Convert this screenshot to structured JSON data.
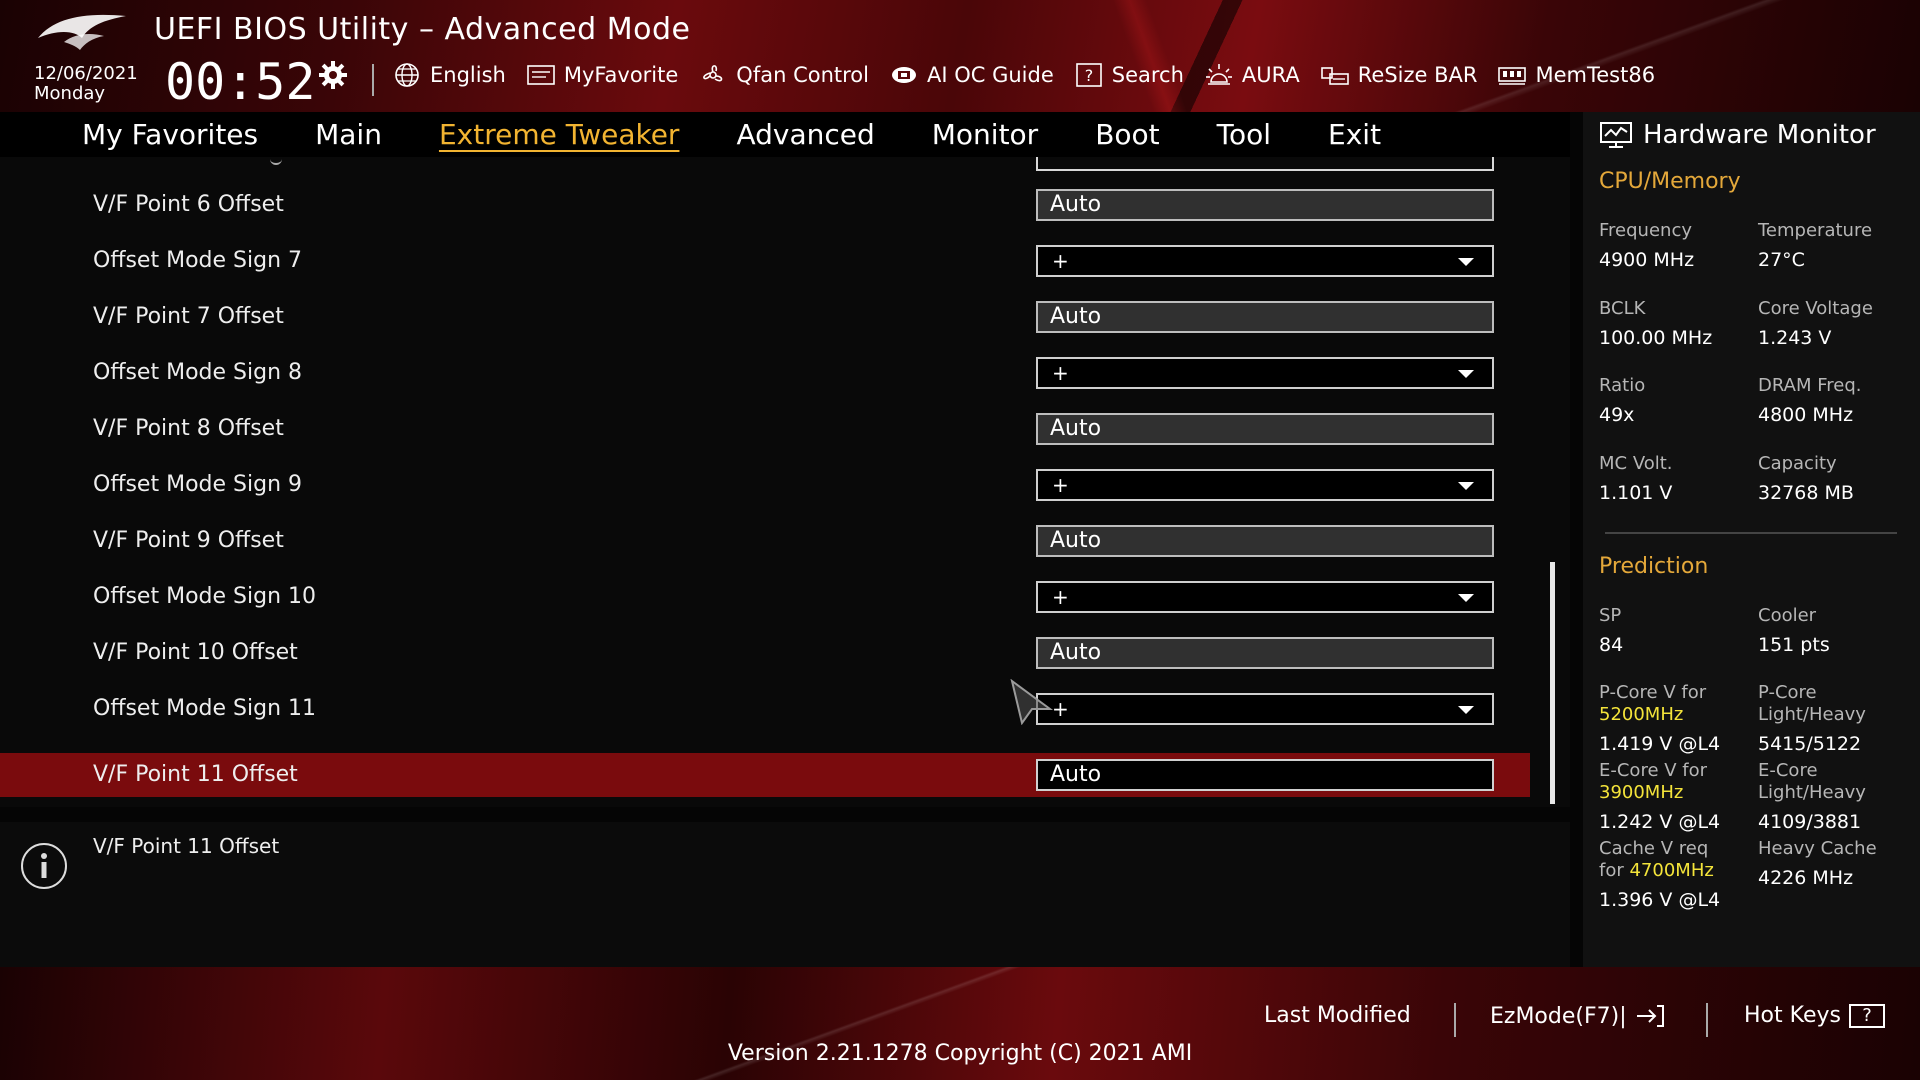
{
  "header": {
    "title": "UEFI BIOS Utility – Advanced Mode",
    "date": "12/06/2021",
    "day": "Monday",
    "time": "00:52"
  },
  "toolbar": [
    {
      "label": "English",
      "icon": "globe-icon"
    },
    {
      "label": "MyFavorite",
      "icon": "favorite-card-icon"
    },
    {
      "label": "Qfan Control",
      "icon": "fan-icon"
    },
    {
      "label": "AI OC Guide",
      "icon": "ai-chip-icon"
    },
    {
      "label": "Search",
      "icon": "search-help-icon"
    },
    {
      "label": "AURA",
      "icon": "aura-light-icon"
    },
    {
      "label": "ReSize BAR",
      "icon": "resize-bar-icon"
    },
    {
      "label": "MemTest86",
      "icon": "memory-icon"
    }
  ],
  "tabs": [
    {
      "label": "My Favorites",
      "active": false
    },
    {
      "label": "Main",
      "active": false
    },
    {
      "label": "Extreme Tweaker",
      "active": true
    },
    {
      "label": "Advanced",
      "active": false
    },
    {
      "label": "Monitor",
      "active": false
    },
    {
      "label": "Boot",
      "active": false
    },
    {
      "label": "Tool",
      "active": false
    },
    {
      "label": "Exit",
      "active": false
    }
  ],
  "settings": [
    {
      "label": "V/F Point 6 Offset",
      "value": "Auto",
      "type": "field"
    },
    {
      "label": "Offset Mode Sign 7",
      "value": "+",
      "type": "dropdown"
    },
    {
      "label": "V/F Point 7 Offset",
      "value": "Auto",
      "type": "field"
    },
    {
      "label": "Offset Mode Sign 8",
      "value": "+",
      "type": "dropdown"
    },
    {
      "label": "V/F Point 8 Offset",
      "value": "Auto",
      "type": "field"
    },
    {
      "label": "Offset Mode Sign 9",
      "value": "+",
      "type": "dropdown"
    },
    {
      "label": "V/F Point 9 Offset",
      "value": "Auto",
      "type": "field"
    },
    {
      "label": "Offset Mode Sign 10",
      "value": "+",
      "type": "dropdown"
    },
    {
      "label": "V/F Point 10 Offset",
      "value": "Auto",
      "type": "field"
    },
    {
      "label": "Offset Mode Sign 11",
      "value": "+",
      "type": "dropdown"
    },
    {
      "label": "V/F Point 11 Offset",
      "value": "Auto",
      "type": "field",
      "selected": true
    }
  ],
  "help": {
    "text": "V/F Point 11 Offset",
    "icon": "info-icon"
  },
  "hardware_monitor": {
    "title": "Hardware Monitor",
    "cpu_memory": {
      "heading": "CPU/Memory",
      "frequency_label": "Frequency",
      "frequency": "4900 MHz",
      "temperature_label": "Temperature",
      "temperature": "27°C",
      "bclk_label": "BCLK",
      "bclk": "100.00 MHz",
      "core_voltage_label": "Core Voltage",
      "core_voltage": "1.243 V",
      "ratio_label": "Ratio",
      "ratio": "49x",
      "dram_freq_label": "DRAM Freq.",
      "dram_freq": "4800 MHz",
      "mc_volt_label": "MC Volt.",
      "mc_volt": "1.101 V",
      "capacity_label": "Capacity",
      "capacity": "32768 MB"
    },
    "prediction": {
      "heading": "Prediction",
      "sp_label": "SP",
      "sp": "84",
      "cooler_label": "Cooler",
      "cooler": "151 pts",
      "pcore_v_label": "P-Core V for",
      "pcore_freq": "5200MHz",
      "pcore_v": "1.419 V @L4",
      "pcore_lh_label_1": "P-Core",
      "pcore_lh_label_2": "Light/Heavy",
      "pcore_lh": "5415/5122",
      "ecore_v_label": "E-Core V for",
      "ecore_freq": "3900MHz",
      "ecore_v": "1.242 V @L4",
      "ecore_lh_label_1": "E-Core",
      "ecore_lh_label_2": "Light/Heavy",
      "ecore_lh": "4109/3881",
      "cache_v_label_1": "Cache V req",
      "cache_v_label_2": "for",
      "cache_freq": "4700MHz",
      "cache_v": "1.396 V @L4",
      "heavy_cache_label": "Heavy Cache",
      "heavy_cache": "4226 MHz"
    }
  },
  "footer": {
    "last_modified": "Last Modified",
    "ezmode": "EzMode(F7)|",
    "hotkeys": "Hot Keys",
    "hotkeys_icon_text": "?",
    "version": "Version 2.21.1278 Copyright (C) 2021 AMI"
  },
  "colors": {
    "accent_gold": "#f2b431",
    "selected_row": "#7a0b0d",
    "highlight_yellow": "#f4e43a"
  }
}
